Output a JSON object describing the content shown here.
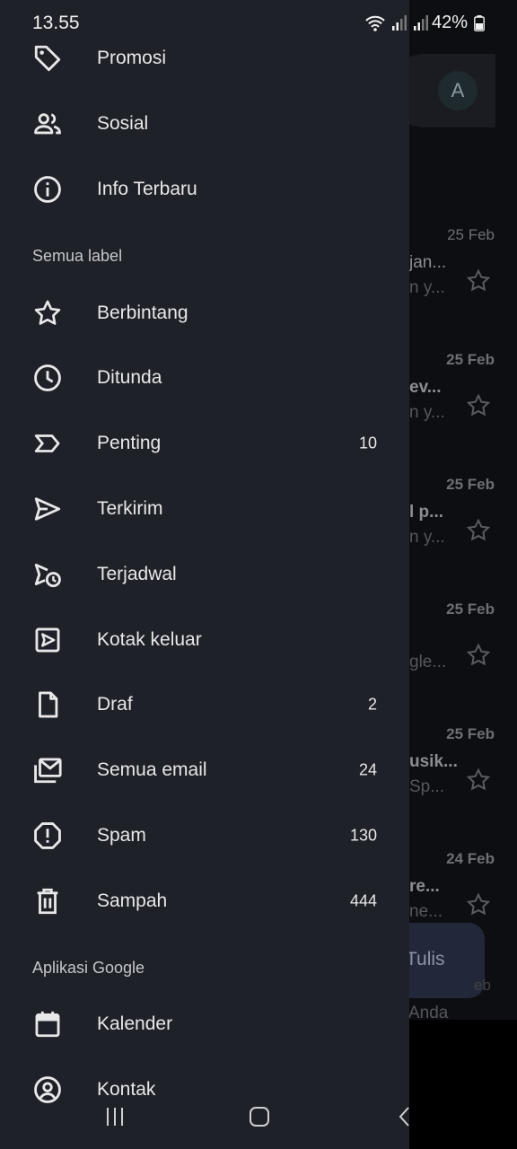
{
  "status_bar": {
    "time": "13.55",
    "battery": "42%"
  },
  "background": {
    "avatar_letter": "A",
    "rows": [
      {
        "date": "25 Feb",
        "subject": "jan...",
        "snippet": "n y..."
      },
      {
        "date": "25 Feb",
        "subject": "ev...",
        "snippet": "n y..."
      },
      {
        "date": "25 Feb",
        "subject": "l p...",
        "snippet": "n y..."
      },
      {
        "date": "25 Feb",
        "subject": "",
        "snippet": "gle..."
      },
      {
        "date": "25 Feb",
        "subject": "usik...",
        "snippet": "Sp..."
      },
      {
        "date": "24 Feb",
        "subject": "re...",
        "snippet": "ne..."
      }
    ],
    "compose_label": "Tulis",
    "footer_text": "Anda",
    "footer_date": "eb"
  },
  "drawer": {
    "top_items": [
      {
        "label": "Promosi",
        "icon": "tag-icon"
      },
      {
        "label": "Sosial",
        "icon": "people-icon"
      },
      {
        "label": "Info Terbaru",
        "icon": "info-icon"
      }
    ],
    "all_labels_header": "Semua label",
    "label_items": [
      {
        "label": "Berbintang",
        "icon": "star-icon",
        "count": ""
      },
      {
        "label": "Ditunda",
        "icon": "clock-icon",
        "count": ""
      },
      {
        "label": "Penting",
        "icon": "important-icon",
        "count": "10"
      },
      {
        "label": "Terkirim",
        "icon": "send-icon",
        "count": ""
      },
      {
        "label": "Terjadwal",
        "icon": "scheduled-send-icon",
        "count": ""
      },
      {
        "label": "Kotak keluar",
        "icon": "outbox-icon",
        "count": ""
      },
      {
        "label": "Draf",
        "icon": "draft-icon",
        "count": "2"
      },
      {
        "label": "Semua email",
        "icon": "all-mail-icon",
        "count": "24"
      },
      {
        "label": "Spam",
        "icon": "spam-icon",
        "count": "130"
      },
      {
        "label": "Sampah",
        "icon": "trash-icon",
        "count": "444"
      }
    ],
    "google_apps_header": "Aplikasi Google",
    "app_items": [
      {
        "label": "Kalender",
        "icon": "calendar-icon"
      },
      {
        "label": "Kontak",
        "icon": "contact-icon"
      }
    ]
  },
  "colors": {
    "drawer_bg": "#1f2128",
    "text": "#e8e8ea",
    "section_text": "#c4c6cc",
    "background": "#0d0e11"
  }
}
